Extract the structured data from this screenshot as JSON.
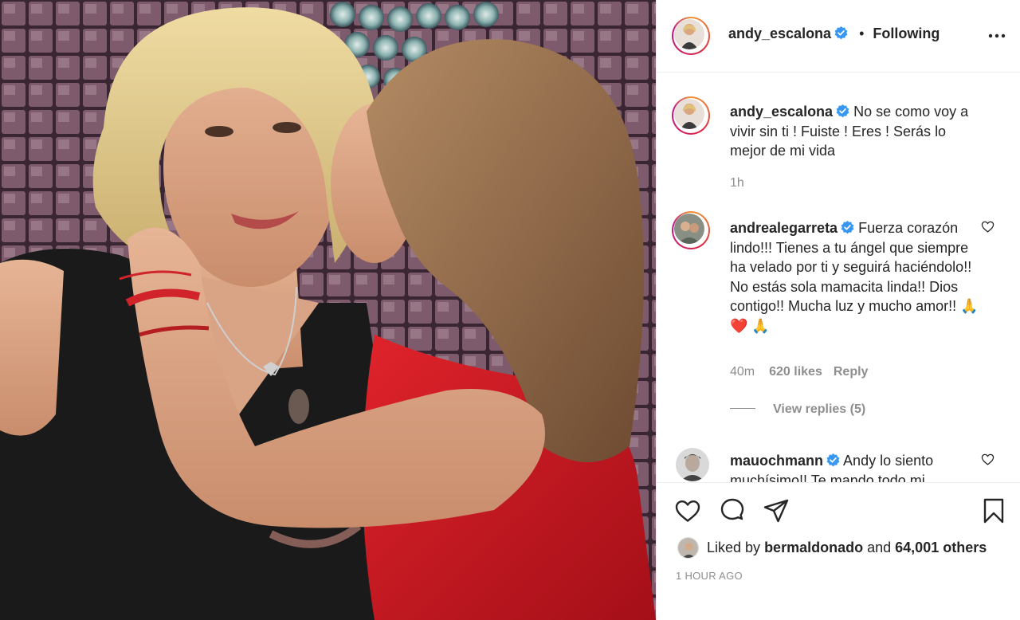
{
  "post": {
    "image_alt": "Photo of two women, one kissing the other's cheek, in front of a sequin wall",
    "header": {
      "username": "andy_escalona",
      "separator": "•",
      "follow_status": "Following"
    },
    "comments": [
      {
        "username": "andy_escalona",
        "text": "No se como voy a vivir sin ti ! Fuiste ! Eres ! Serás lo mejor de mi vida",
        "time": "1h"
      },
      {
        "username": "andrealegarreta",
        "text": "Fuerza corazón lindo!!! Tienes a tu ángel que siempre ha velado por ti y seguirá haciéndolo!! No estás sola mamacita linda!! Dios contigo!! Mucha luz y mucho amor!!",
        "emojis": "🙏❤️ 🙏",
        "time": "40m",
        "likes": "620 likes",
        "reply": "Reply",
        "view_replies": "View replies (5)"
      },
      {
        "username": "mauochmann",
        "text": "Andy lo siento muchísimo!! Te mando todo mi"
      }
    ],
    "actions": {
      "liked_by_prefix": "Liked by",
      "liked_by_user": "bermaldonado",
      "liked_by_and": "and",
      "liked_by_others": "64,001 others",
      "timestamp": "1 HOUR AGO"
    },
    "colors": {
      "verified": "#3897f0",
      "text": "#262626",
      "muted": "#8e8e8e",
      "divider": "#efefef"
    },
    "icons": {
      "more": "more-icon",
      "like": "heart-icon",
      "comment": "comment-icon",
      "share": "share-icon",
      "save": "bookmark-icon",
      "verified": "verified-badge-icon"
    }
  }
}
